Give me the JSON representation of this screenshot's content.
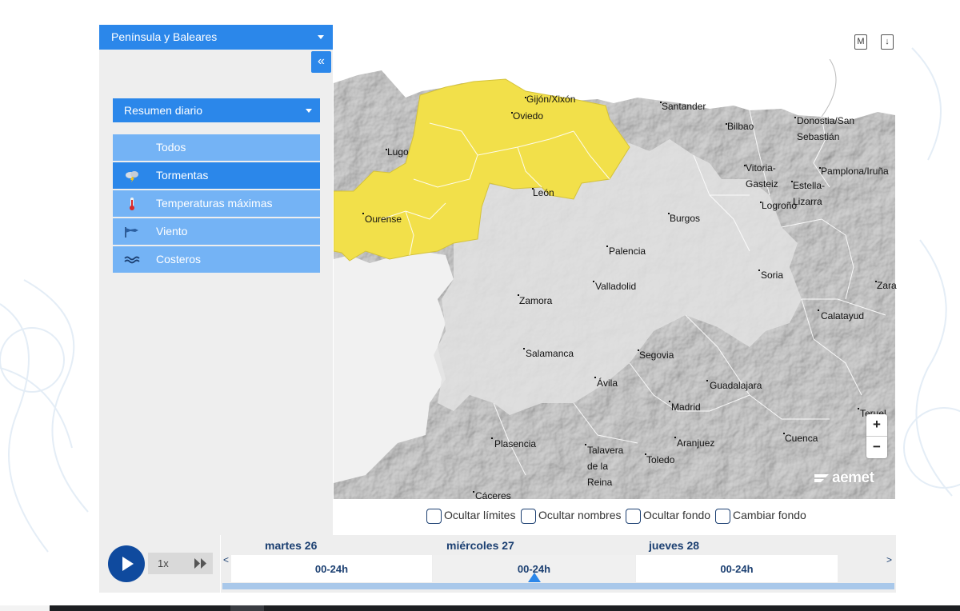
{
  "region_selector": {
    "label": "Península y Baleares"
  },
  "collapse_label": "«",
  "summary_selector": {
    "label": "Resumen diario"
  },
  "layers": [
    {
      "label": "Todos",
      "icon": "none",
      "active": false
    },
    {
      "label": "Tormentas",
      "icon": "storm-cloud-icon",
      "active": true
    },
    {
      "label": "Temperaturas máximas",
      "icon": "thermometer-icon",
      "active": false
    },
    {
      "label": "Viento",
      "icon": "wind-flag-icon",
      "active": false
    },
    {
      "label": "Costeros",
      "icon": "waves-icon",
      "active": false
    }
  ],
  "top_icons": {
    "m_label": "M",
    "download_label": "↓"
  },
  "map": {
    "warning_color": "#f2e04a",
    "land_color": "#d2d2d2",
    "cities": [
      {
        "name": "Gijón/Xixón"
      },
      {
        "name": "Oviedo"
      },
      {
        "name": "Santander"
      },
      {
        "name": "Bilbao"
      },
      {
        "name": "Donostia/San"
      },
      {
        "name": "Sebastián"
      },
      {
        "name": "Lugo"
      },
      {
        "name": "Vitoria-"
      },
      {
        "name": "Gasteiz"
      },
      {
        "name": "Estella-"
      },
      {
        "name": "Lizarra"
      },
      {
        "name": "Pamplona/Iruña"
      },
      {
        "name": "León"
      },
      {
        "name": "Logroño"
      },
      {
        "name": "Burgos"
      },
      {
        "name": "Ourense"
      },
      {
        "name": "Palencia"
      },
      {
        "name": "Soria"
      },
      {
        "name": "Valladolid"
      },
      {
        "name": "Zara"
      },
      {
        "name": "Zamora"
      },
      {
        "name": "Calatayud"
      },
      {
        "name": "Salamanca"
      },
      {
        "name": "Segovia"
      },
      {
        "name": "Ávila"
      },
      {
        "name": "Guadalajara"
      },
      {
        "name": "Madrid"
      },
      {
        "name": "Teruel"
      },
      {
        "name": "Plasencia"
      },
      {
        "name": "Talavera"
      },
      {
        "name": "de la"
      },
      {
        "name": "Reina"
      },
      {
        "name": "Aranjuez"
      },
      {
        "name": "Toledo"
      },
      {
        "name": "Cuenca"
      },
      {
        "name": "Cáceres"
      }
    ],
    "zoom_in": "+",
    "zoom_out": "−",
    "logo_text": "aemet"
  },
  "options": [
    {
      "label": "Ocultar límites"
    },
    {
      "label": "Ocultar nombres"
    },
    {
      "label": "Ocultar fondo"
    },
    {
      "label": "Cambiar fondo"
    }
  ],
  "player": {
    "speed": "1x"
  },
  "timeline": {
    "prev": "<",
    "next": ">",
    "days": [
      {
        "day": "martes 26",
        "period": "00-24h"
      },
      {
        "day": "miércoles 27",
        "period": "00-24h",
        "selected": true
      },
      {
        "day": "jueves 28",
        "period": "00-24h"
      }
    ]
  }
}
